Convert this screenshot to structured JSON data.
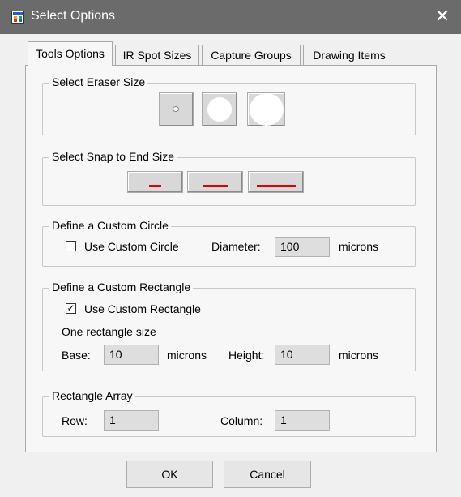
{
  "window": {
    "title": "Select Options",
    "close_glyph": "✕"
  },
  "tabs": [
    {
      "label": "Tools Options",
      "active": true
    },
    {
      "label": "IR Spot Sizes",
      "active": false
    },
    {
      "label": "Capture Groups",
      "active": false
    },
    {
      "label": "Drawing Items",
      "active": false
    }
  ],
  "eraser": {
    "legend": "Select Eraser Size",
    "buttons": [
      "small",
      "medium",
      "large"
    ]
  },
  "snap": {
    "legend": "Select Snap to End Size",
    "buttons": [
      "short",
      "medium",
      "long"
    ],
    "line_color": "#e00000"
  },
  "circle": {
    "legend": "Define a Custom Circle",
    "checkbox_label": "Use Custom Circle",
    "checked": false,
    "diameter_label": "Diameter:",
    "diameter_value": "100",
    "unit": "microns"
  },
  "rectangle": {
    "legend": "Define a Custom Rectangle",
    "checkbox_label": "Use Custom Rectangle",
    "checked": true,
    "check_glyph": "✓",
    "size_caption": "One rectangle size",
    "base_label": "Base:",
    "base_value": "10",
    "base_unit": "microns",
    "height_label": "Height:",
    "height_value": "10",
    "height_unit": "microns"
  },
  "array": {
    "legend": "Rectangle Array",
    "row_label": "Row:",
    "row_value": "1",
    "column_label": "Column:",
    "column_value": "1"
  },
  "buttons": {
    "ok": "OK",
    "cancel": "Cancel"
  }
}
